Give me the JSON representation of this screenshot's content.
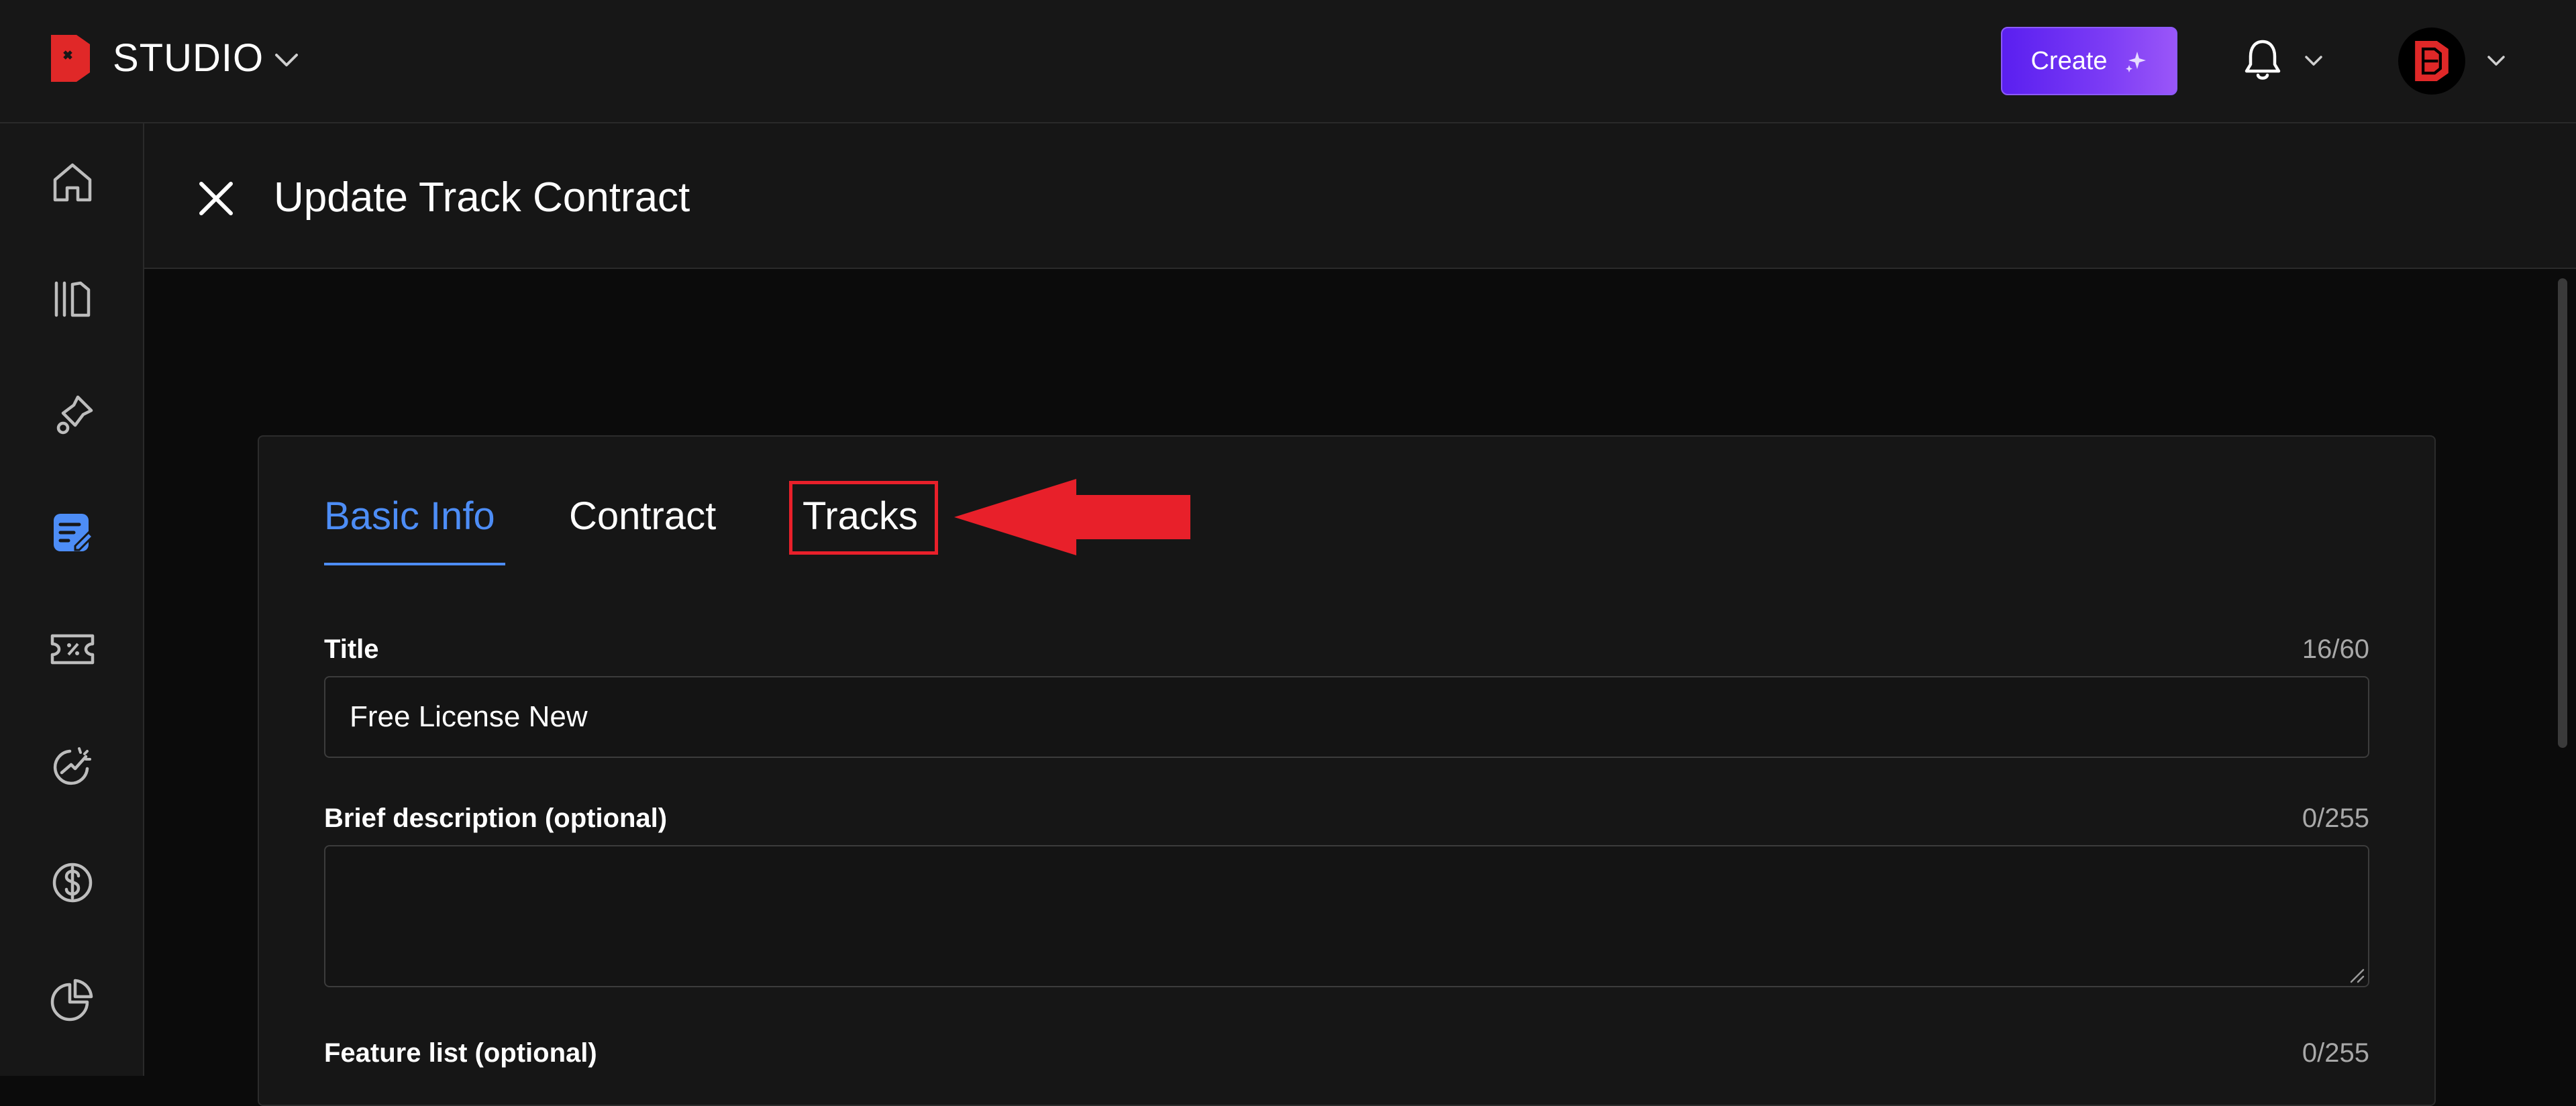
{
  "app": {
    "brand": "STUDIO"
  },
  "topbar": {
    "create_label": "Create"
  },
  "page": {
    "title": "Update Track Contract"
  },
  "tabs": [
    {
      "label": "Basic Info",
      "active": true
    },
    {
      "label": "Contract",
      "active": false
    },
    {
      "label": "Tracks",
      "active": false
    }
  ],
  "form": {
    "title": {
      "label": "Title",
      "value": "Free License New",
      "count": "16/60"
    },
    "description": {
      "label": "Brief description (optional)",
      "value": "",
      "count": "0/255"
    },
    "features": {
      "label": "Feature list (optional)",
      "count": "0/255"
    }
  },
  "sidebar": {
    "items": [
      {
        "icon": "home-icon"
      },
      {
        "icon": "library-icon"
      },
      {
        "icon": "pin-icon"
      },
      {
        "icon": "contracts-icon",
        "active": true
      },
      {
        "icon": "coupon-icon"
      },
      {
        "icon": "analytics-icon"
      },
      {
        "icon": "dollar-icon"
      },
      {
        "icon": "pie-chart-icon"
      }
    ]
  },
  "colors": {
    "accent": "#4d8df6",
    "create": "#6a2ff2",
    "highlight": "#e8202a",
    "brand_red": "#e02828"
  }
}
